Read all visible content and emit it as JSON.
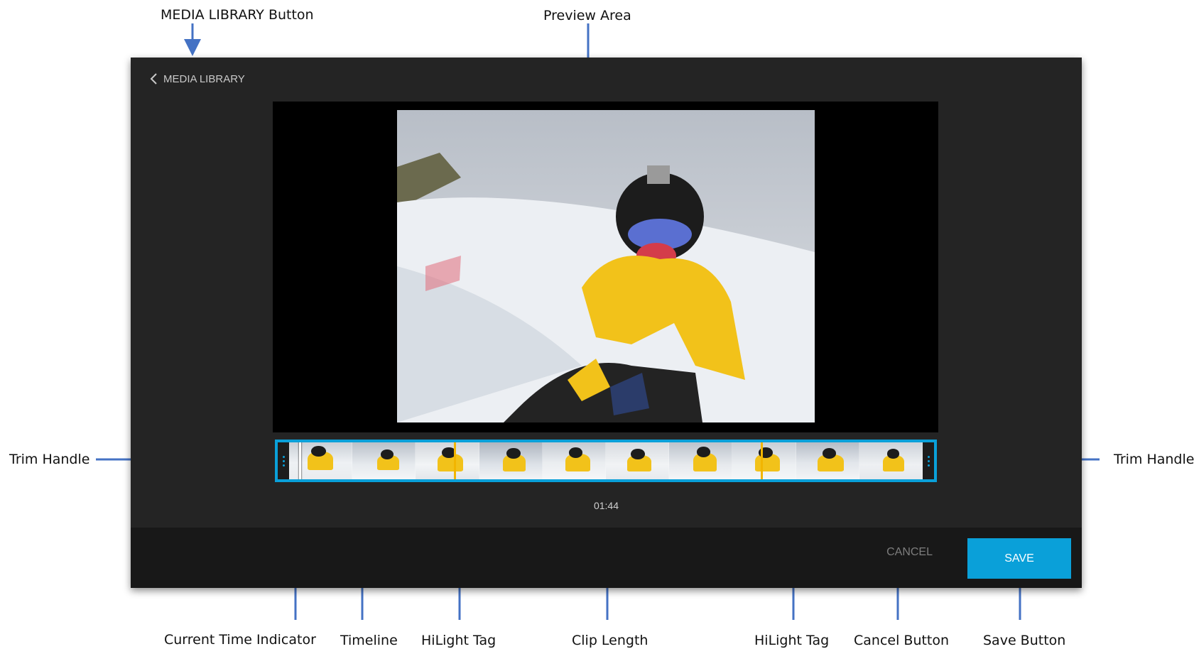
{
  "annotations": {
    "media_library_button": "MEDIA LIBRARY Button",
    "preview_area": "Preview Area",
    "trim_handle_left": "Trim Handle",
    "trim_handle_right": "Trim Handle",
    "current_time_indicator": "Current Time Indicator",
    "timeline": "Timeline",
    "hilight_tag_1": "HiLight Tag",
    "clip_length": "Clip Length",
    "hilight_tag_2": "HiLight Tag",
    "cancel_button": "Cancel Button",
    "save_button": "Save Button"
  },
  "app": {
    "back_label": "MEDIA LIBRARY",
    "clip_length": "01:44",
    "cancel_label": "CANCEL",
    "save_label": "SAVE"
  },
  "icons": {
    "back": "chevron-left-icon",
    "trim_handle": "drag-dots-icon"
  },
  "colors": {
    "accent": "#0aa0d9",
    "app_background": "#242424",
    "footer_background": "#181818",
    "hilight": "#f2b500",
    "annotation_arrow": "#4472c4"
  }
}
